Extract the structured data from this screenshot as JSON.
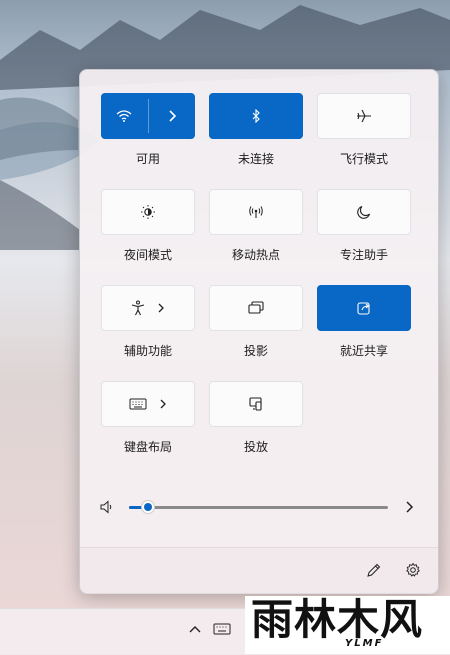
{
  "quick_settings": {
    "tiles": [
      {
        "label": "可用",
        "icon": "wifi-icon",
        "active": true
      },
      {
        "label": "未连接",
        "icon": "bluetooth-icon",
        "active": true
      },
      {
        "label": "飞行模式",
        "icon": "airplane-icon",
        "active": false
      },
      {
        "label": "夜间模式",
        "icon": "brightness-icon",
        "active": false
      },
      {
        "label": "移动热点",
        "icon": "hotspot-icon",
        "active": false
      },
      {
        "label": "专注助手",
        "icon": "moon-icon",
        "active": false
      },
      {
        "label": "辅助功能",
        "icon": "accessibility-icon",
        "active": false
      },
      {
        "label": "投影",
        "icon": "project-icon",
        "active": false
      },
      {
        "label": "就近共享",
        "icon": "share-icon",
        "active": true
      },
      {
        "label": "键盘布局",
        "icon": "keyboard-icon",
        "active": false
      },
      {
        "label": "投放",
        "icon": "cast-icon",
        "active": false
      }
    ],
    "volume": {
      "level": 0.07,
      "icon": "speaker-icon"
    },
    "footer": {
      "edit_icon": "pencil-icon",
      "settings_icon": "gear-icon"
    }
  },
  "watermark": {
    "text": "雨林木风",
    "sub": "YLMF"
  },
  "colors": {
    "accent": "#0967c5",
    "panel": "#f5f0f2"
  }
}
